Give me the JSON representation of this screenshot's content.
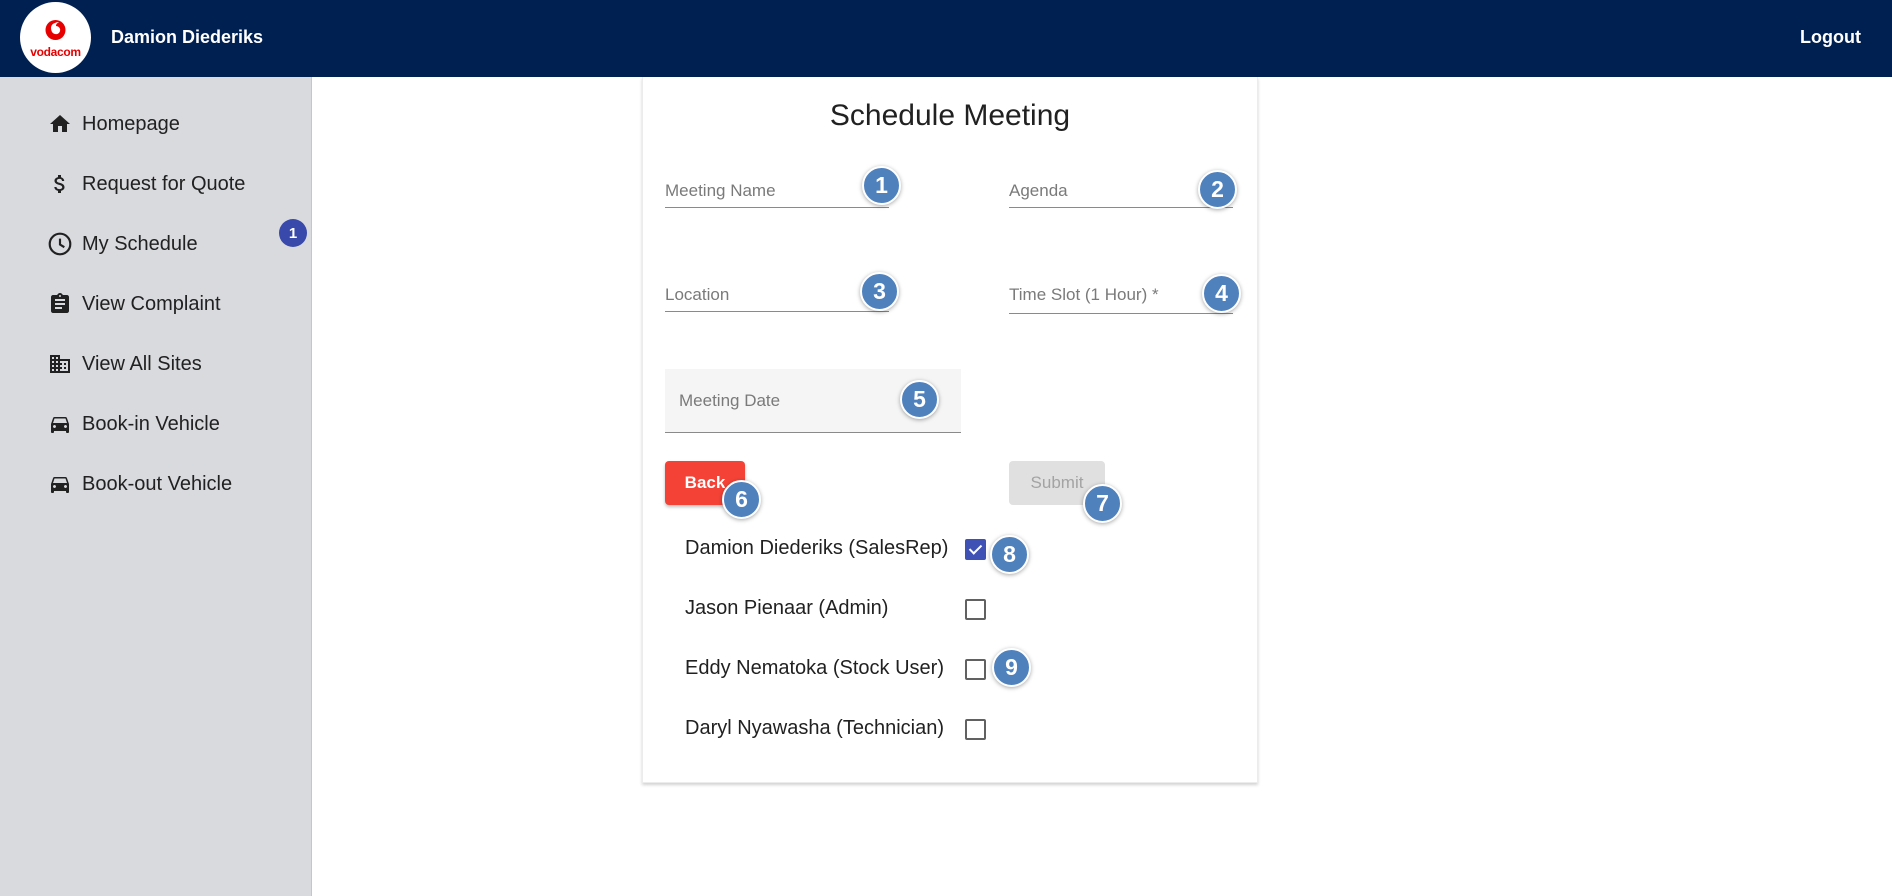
{
  "header": {
    "logo_text": "vodacom",
    "user_name": "Damion Diederiks",
    "logout_label": "Logout"
  },
  "sidebar": {
    "items": [
      {
        "label": "Homepage",
        "icon": "home-icon"
      },
      {
        "label": "Request for Quote",
        "icon": "dollar-icon"
      },
      {
        "label": "My Schedule",
        "icon": "clock-icon"
      },
      {
        "label": "View Complaint",
        "icon": "clipboard-icon"
      },
      {
        "label": "View All Sites",
        "icon": "building-icon"
      },
      {
        "label": "Book-in Vehicle",
        "icon": "car-icon"
      },
      {
        "label": "Book-out Vehicle",
        "icon": "car-icon"
      }
    ],
    "badge": "1"
  },
  "form": {
    "title": "Schedule Meeting",
    "meeting_name_placeholder": "Meeting Name",
    "agenda_placeholder": "Agenda",
    "location_placeholder": "Location",
    "time_slot_placeholder": "Time Slot (1 Hour) *",
    "meeting_date_placeholder": "Meeting Date",
    "back_label": "Back",
    "submit_label": "Submit",
    "attendees": [
      {
        "name": "Damion Diederiks (SalesRep)",
        "checked": true
      },
      {
        "name": "Jason Pienaar (Admin)",
        "checked": false
      },
      {
        "name": "Eddy Nematoka (Stock User)",
        "checked": false
      },
      {
        "name": "Daryl Nyawasha (Technician)",
        "checked": false
      }
    ]
  },
  "markers": [
    "1",
    "2",
    "3",
    "4",
    "5",
    "6",
    "7",
    "8",
    "9"
  ],
  "colors": {
    "header_bg": "#012052",
    "sidebar_bg": "#d9dade",
    "back_button": "#f44336",
    "checkbox_checked": "#3f51b5",
    "marker": "#4f81bd",
    "brand_red": "#e60000"
  }
}
